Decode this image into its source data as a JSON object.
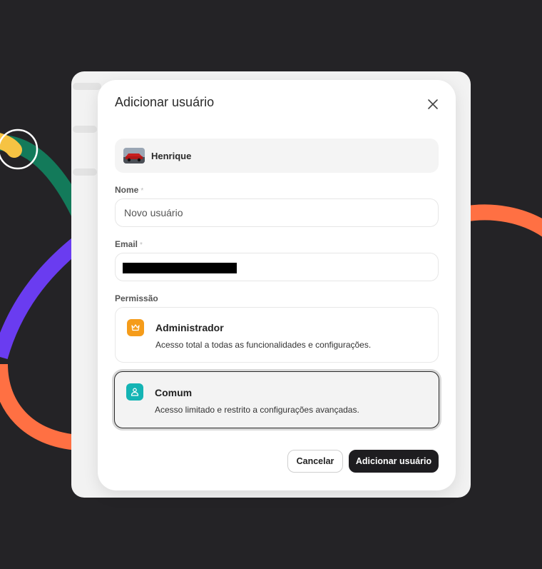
{
  "colors": {
    "background": "#242326",
    "accent_dark": "#1e1d20",
    "admin_icon_bg": "#f59c1a",
    "common_icon_bg": "#14b4b4",
    "decor_green": "#137a5a",
    "decor_orange": "#ff7043",
    "decor_purple": "#6a3cf0",
    "decor_yellow": "#f6c343"
  },
  "dialog": {
    "title": "Adicionar usuário",
    "close_icon": "close-icon",
    "user": {
      "name": "Henrique",
      "avatar_icon": "car-photo-avatar"
    },
    "name_field": {
      "label": "Nome",
      "required_mark": "*",
      "placeholder": "Novo usuário",
      "value": ""
    },
    "email_field": {
      "label": "Email",
      "required_mark": "*",
      "value": "",
      "redacted": true
    },
    "permission": {
      "label": "Permissão",
      "selected": "Comum",
      "options": [
        {
          "title": "Administrador",
          "description": "Acesso total a todas as funcionalidades e configurações.",
          "icon": "crown-icon"
        },
        {
          "title": "Comum",
          "description": "Acesso limitado e restrito a configurações avançadas.",
          "icon": "user-icon"
        }
      ]
    },
    "buttons": {
      "cancel": "Cancelar",
      "submit": "Adicionar usuário"
    }
  }
}
